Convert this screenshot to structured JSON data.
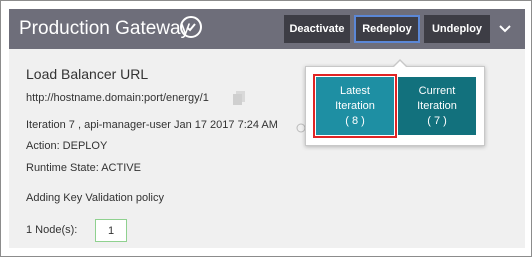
{
  "header": {
    "title": "Production Gateway",
    "buttons": {
      "deactivate": "Deactivate",
      "redeploy": "Redeploy",
      "undeploy": "Undeploy"
    }
  },
  "details": {
    "section_title": "Load Balancer URL",
    "url": "http://hostname.domain:port/energy/1",
    "iteration_line": "Iteration 7 , api-manager-user  Jan 17 2017 7:24 AM",
    "action": "Action: DEPLOY",
    "runtime_state": "Runtime State: ACTIVE",
    "policy_status": "Adding Key Validation policy",
    "nodes_label": "1 Node(s):",
    "nodes_value": "1"
  },
  "redeploy_popup": {
    "latest": {
      "line1": "Latest",
      "line2": "Iteration",
      "line3": "( 8 )"
    },
    "current": {
      "line1": "Current",
      "line2": "Iteration",
      "line3": "( 7 )"
    }
  },
  "colors": {
    "header_bg": "#6e6e7a",
    "button_bg": "#3d3d45",
    "latest_bg": "#1e8fa3",
    "current_bg": "#12717d",
    "highlight": "#e02424"
  },
  "icons": [
    "check-circle-icon",
    "chevron-down-icon",
    "copy-icon",
    "info-icon"
  ]
}
